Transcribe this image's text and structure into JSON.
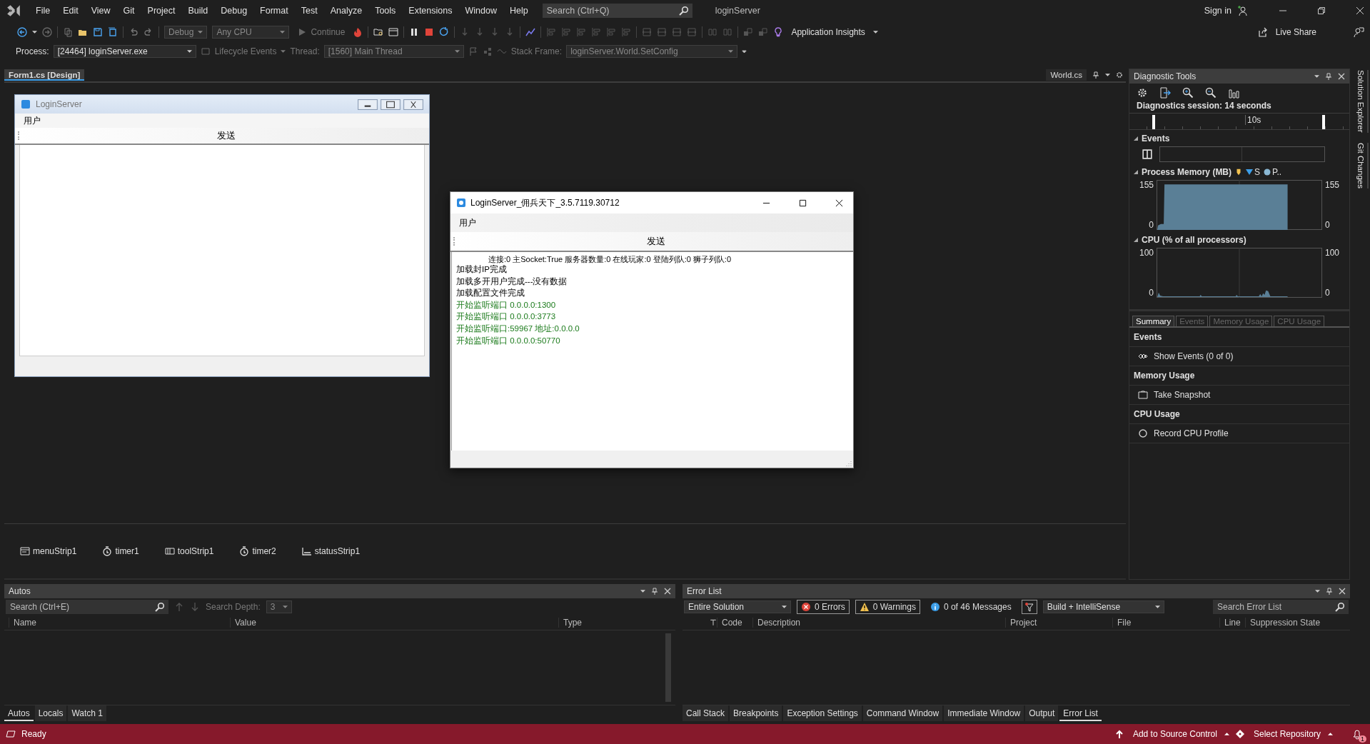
{
  "menu_bar": {
    "items": [
      "File",
      "Edit",
      "View",
      "Git",
      "Project",
      "Build",
      "Debug",
      "Format",
      "Test",
      "Analyze",
      "Tools",
      "Extensions",
      "Window",
      "Help"
    ],
    "search": {
      "placeholder": "Search (Ctrl+Q)"
    },
    "solution_name": "loginServer",
    "sign_in": "Sign in"
  },
  "toolbar": {
    "configuration": "Debug",
    "platform": "Any CPU",
    "continue": "Continue",
    "application_insights": "Application Insights",
    "live_share": "Live Share"
  },
  "debug_location": {
    "process_label": "Process:",
    "process": "[24464] loginServer.exe",
    "lifecycle_events": "Lifecycle Events",
    "thread_label": "Thread:",
    "thread": "[1560] Main Thread",
    "stack_frame_label": "Stack Frame:",
    "stack_frame": "loginServer.World.SetConfig"
  },
  "document_tabs": [
    {
      "label": "Form1.cs [Design]",
      "selected": true
    },
    {
      "label": "World.cs",
      "selected": false
    }
  ],
  "designer": {
    "form": {
      "title": "LoginServer",
      "menu": [
        "用户"
      ],
      "toolbar_button": "发送"
    },
    "component_tray": [
      {
        "label": "menuStrip1",
        "kind": "menu"
      },
      {
        "label": "timer1",
        "kind": "timer"
      },
      {
        "label": "toolStrip1",
        "kind": "toolstrip"
      },
      {
        "label": "timer2",
        "kind": "timer"
      },
      {
        "label": "statusStrip1",
        "kind": "statusstrip"
      }
    ]
  },
  "running_window": {
    "title": "LoginServer_佣兵天下_3.5.7119.30712",
    "menu": [
      "用户"
    ],
    "toolbar_button": "发送",
    "status_line": "连接:0 主Socket:True  服务器数量:0  在线玩家:0  登陆列队:0  狮子列队:0",
    "log": [
      {
        "text": "加载封IP完成",
        "kind": "info"
      },
      {
        "text": "加载多开用户完成---没有数据",
        "kind": "info"
      },
      {
        "text": "加载配置文件完成",
        "kind": "info"
      },
      {
        "text": "开始监听端口 0.0.0.0:1300",
        "kind": "success"
      },
      {
        "text": "开始监听端口 0.0.0.0:3773",
        "kind": "success"
      },
      {
        "text": "开始监听端口:59967 地址:0.0.0.0",
        "kind": "success"
      },
      {
        "text": "开始监听端口 0.0.0.0:50770",
        "kind": "success"
      }
    ]
  },
  "diagnostic_tools": {
    "title": "Diagnostic Tools",
    "session": "Diagnostics session: 14 seconds",
    "timeline_tick": "10s",
    "events_title": "Events",
    "memory": {
      "title": "Process Memory (MB)",
      "legend": [
        {
          "label": "S",
          "kind": "snapshot"
        },
        {
          "label": "P..",
          "kind": "private"
        }
      ],
      "left_axis": [
        "155",
        "0"
      ],
      "right_axis": [
        "155",
        "0"
      ]
    },
    "cpu": {
      "title": "CPU (% of all processors)",
      "left_axis": [
        "100",
        "0"
      ],
      "right_axis": [
        "100",
        "0"
      ]
    },
    "tabs": [
      {
        "label": "Summary",
        "selected": true,
        "disabled": false
      },
      {
        "label": "Events",
        "selected": false,
        "disabled": true
      },
      {
        "label": "Memory Usage",
        "selected": false,
        "disabled": true
      },
      {
        "label": "CPU Usage",
        "selected": false,
        "disabled": true
      }
    ],
    "sections": [
      {
        "heading": "Events",
        "action": "Show Events (0 of 0)",
        "kind": "events"
      },
      {
        "heading": "Memory Usage",
        "action": "Take Snapshot",
        "kind": "snapshot"
      },
      {
        "heading": "CPU Usage",
        "action": "Record CPU Profile",
        "kind": "record"
      }
    ]
  },
  "side_tabs": [
    "Solution Explorer",
    "Git Changes"
  ],
  "autos": {
    "title": "Autos",
    "search": {
      "placeholder": "Search (Ctrl+E)"
    },
    "search_depth_label": "Search Depth:",
    "search_depth": "3",
    "columns": [
      "Name",
      "Value",
      "Type"
    ],
    "tabs": [
      {
        "label": "Autos",
        "selected": true
      },
      {
        "label": "Locals",
        "selected": false
      },
      {
        "label": "Watch 1",
        "selected": false
      }
    ]
  },
  "error_list": {
    "title": "Error List",
    "scope": "Entire Solution",
    "errors": "0 Errors",
    "warnings": "0 Warnings",
    "messages": "0 of 46 Messages",
    "source": "Build + IntelliSense",
    "search": {
      "placeholder": "Search Error List"
    },
    "columns": [
      "Code",
      "Description",
      "Project",
      "File",
      "Line",
      "Suppression State"
    ],
    "tabs": [
      {
        "label": "Call Stack",
        "selected": false
      },
      {
        "label": "Breakpoints",
        "selected": false
      },
      {
        "label": "Exception Settings",
        "selected": false
      },
      {
        "label": "Command Window",
        "selected": false
      },
      {
        "label": "Immediate Window",
        "selected": false
      },
      {
        "label": "Output",
        "selected": false
      },
      {
        "label": "Error List",
        "selected": true
      }
    ]
  },
  "status_bar": {
    "text": "Ready",
    "add_to_source_control": "Add to Source Control",
    "select_repository": "Select Repository",
    "notifications": "1"
  }
}
